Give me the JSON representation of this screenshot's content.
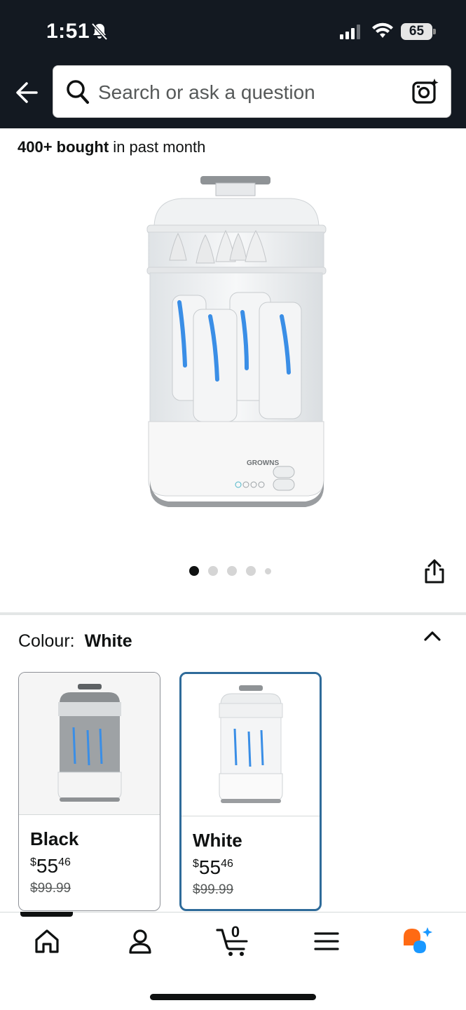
{
  "status_bar": {
    "time": "1:51",
    "battery": "65"
  },
  "search": {
    "placeholder": "Search or ask a question"
  },
  "product": {
    "bought_count": "400+ bought",
    "bought_suffix": " in past month",
    "brand_on_image": "GROWNS",
    "carousel": {
      "total": 5,
      "active_index": 0
    }
  },
  "colour": {
    "label": "Colour:",
    "selected": "White",
    "options": [
      {
        "name": "Black",
        "symbol": "$",
        "whole": "55",
        "fraction": "46",
        "list_price": "$99.99"
      },
      {
        "name": "White",
        "symbol": "$",
        "whole": "55",
        "fraction": "46",
        "list_price": "$99.99"
      }
    ]
  },
  "nav": {
    "cart_count": "0"
  },
  "icons": {
    "back": "back-arrow-icon",
    "search": "search-icon",
    "camera": "camera-icon",
    "share": "share-icon",
    "chevron": "chevron-up-icon",
    "home": "home-icon",
    "account": "account-icon",
    "cart": "cart-icon",
    "menu": "menu-icon",
    "rufus": "rufus-icon"
  },
  "colors": {
    "header": "#131921",
    "selected_border": "#2f6b9a",
    "rufus_orange": "#ff6a13",
    "rufus_blue": "#1a98ff"
  }
}
